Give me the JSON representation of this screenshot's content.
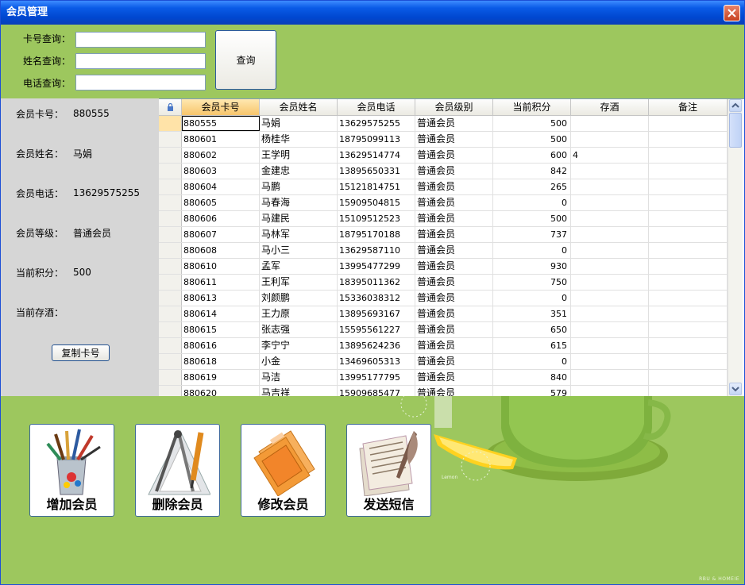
{
  "window": {
    "title": "会员管理"
  },
  "search": {
    "card_label": "卡号查询：",
    "name_label": "姓名查询：",
    "phone_label": "电话查询：",
    "card_value": "",
    "name_value": "",
    "phone_value": "",
    "query_button": "查询"
  },
  "info": {
    "card_label": "会员卡号：",
    "card_value": "880555",
    "name_label": "会员姓名：",
    "name_value": "马娟",
    "phone_label": "会员电话：",
    "phone_value": "13629575255",
    "level_label": "会员等级：",
    "level_value": "普通会员",
    "points_label": "当前积分：",
    "points_value": "500",
    "wine_label": "当前存酒：",
    "wine_value": "",
    "copy_button": "复制卡号"
  },
  "grid": {
    "columns": [
      "会员卡号",
      "会员姓名",
      "会员电话",
      "会员级别",
      "当前积分",
      "存酒",
      "备注"
    ],
    "rows": [
      [
        "880555",
        "马娟",
        "13629575255",
        "普通会员",
        "500",
        "",
        ""
      ],
      [
        "880601",
        "杨桂华",
        "18795099113",
        "普通会员",
        "500",
        "",
        ""
      ],
      [
        "880602",
        "王学明",
        "13629514774",
        "普通会员",
        "600",
        "4",
        ""
      ],
      [
        "880603",
        "金建忠",
        "13895650331",
        "普通会员",
        "842",
        "",
        ""
      ],
      [
        "880604",
        "马鹏",
        "15121814751",
        "普通会员",
        "265",
        "",
        ""
      ],
      [
        "880605",
        "马春海",
        "15909504815",
        "普通会员",
        "0",
        "",
        ""
      ],
      [
        "880606",
        "马建民",
        "15109512523",
        "普通会员",
        "500",
        "",
        ""
      ],
      [
        "880607",
        "马林军",
        "18795170188",
        "普通会员",
        "737",
        "",
        ""
      ],
      [
        "880608",
        "马小三",
        "13629587110",
        "普通会员",
        "0",
        "",
        ""
      ],
      [
        "880610",
        "孟军",
        "13995477299",
        "普通会员",
        "930",
        "",
        ""
      ],
      [
        "880611",
        "王利军",
        "18395011362",
        "普通会员",
        "750",
        "",
        ""
      ],
      [
        "880613",
        "刘颜鹏",
        "15336038312",
        "普通会员",
        "0",
        "",
        ""
      ],
      [
        "880614",
        "王力原",
        "13895693167",
        "普通会员",
        "351",
        "",
        ""
      ],
      [
        "880615",
        "张志强",
        "15595561227",
        "普通会员",
        "650",
        "",
        ""
      ],
      [
        "880616",
        "李宁宁",
        "13895624236",
        "普通会员",
        "615",
        "",
        ""
      ],
      [
        "880618",
        "小金",
        "13469605313",
        "普通会员",
        "0",
        "",
        ""
      ],
      [
        "880619",
        "马洁",
        "13995177795",
        "普通会员",
        "840",
        "",
        ""
      ],
      [
        "880620",
        "马吉祥",
        "15909685477",
        "普通会员",
        "579",
        "",
        ""
      ]
    ]
  },
  "actions": {
    "add": "增加会员",
    "delete": "删除会员",
    "edit": "修改会员",
    "sms": "发送短信"
  },
  "decor": {
    "lemon_text": "Lemon",
    "watermark": "RBU & HOMEIE"
  },
  "colors": {
    "background": "#9dc75e",
    "titlebar": "#0a5be6",
    "sorted_header": "#f7c56c"
  }
}
